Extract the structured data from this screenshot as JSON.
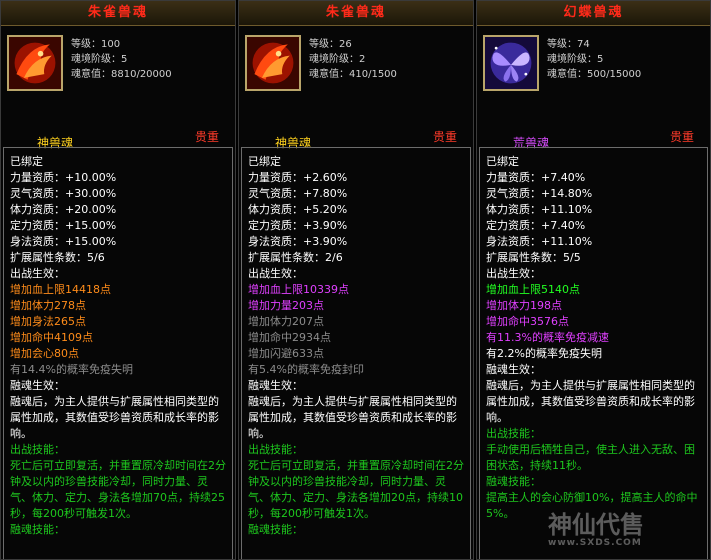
{
  "cards": [
    {
      "title": "朱雀兽魂",
      "level": "等级：100",
      "realm": "魂境阶级：5",
      "soul": "魂意值：8810/20000",
      "type": "神兽魂",
      "precious": "贵重",
      "bound": "已绑定",
      "attrs": [
        "力量资质：+10.00%",
        "灵气资质：+30.00%",
        "体力资质：+20.00%",
        "定力资质：+15.00%",
        "身法资质：+15.00%"
      ],
      "ext": "扩展属性条数：5/6",
      "battle_label": "出战生效：",
      "effects": [
        {
          "text": "增加血上限14418点",
          "color": "o"
        },
        {
          "text": "增加体力278点",
          "color": "o"
        },
        {
          "text": "增加身法265点",
          "color": "o"
        },
        {
          "text": "增加命中4109点",
          "color": "o"
        },
        {
          "text": "增加会心80点",
          "color": "o"
        },
        {
          "text": "有14.4%的概率免疫失明",
          "color": "g"
        }
      ],
      "fuse_label": "融魂生效：",
      "fuse_text": "融魂后，为主人提供与扩展属性相同类型的属性加成，其数值受珍兽资质和成长率的影响。",
      "skill_label": "出战技能：",
      "skill_text": "死亡后可立即复活，并重置原冷却时间在2分钟及以内的珍兽技能冷却，同时力量、灵气、体力、定力、身法各增加70点，持续25秒，每200秒可触发1次。",
      "fuse_skill_label": "融魂技能："
    },
    {
      "title": "朱雀兽魂",
      "level": "等级：26",
      "realm": "魂境阶级：2",
      "soul": "魂意值：410/1500",
      "type": "神兽魂",
      "precious": "贵重",
      "bound": "已绑定",
      "attrs": [
        "力量资质：+2.60%",
        "灵气资质：+7.80%",
        "体力资质：+5.20%",
        "定力资质：+3.90%",
        "身法资质：+3.90%"
      ],
      "ext": "扩展属性条数：2/6",
      "battle_label": "出战生效：",
      "effects": [
        {
          "text": "增加血上限10339点",
          "color": "p"
        },
        {
          "text": "增加力量203点",
          "color": "p"
        },
        {
          "text": "增加体力207点",
          "color": "g"
        },
        {
          "text": "增加命中2934点",
          "color": "g"
        },
        {
          "text": "增加闪避633点",
          "color": "g"
        },
        {
          "text": "有5.4%的概率免疫封印",
          "color": "g"
        }
      ],
      "fuse_label": "融魂生效：",
      "fuse_text": "融魂后，为主人提供与扩展属性相同类型的属性加成，其数值受珍兽资质和成长率的影响。",
      "skill_label": "出战技能：",
      "skill_text": "死亡后可立即复活，并重置原冷却时间在2分钟及以内的珍兽技能冷却，同时力量、灵气、体力、定力、身法各增加20点，持续10秒，每200秒可触发1次。",
      "fuse_skill_label": "融魂技能："
    },
    {
      "title": "幻蝶兽魂",
      "level": "等级：74",
      "realm": "魂境阶级：5",
      "soul": "魂意值：500/15000",
      "type": "荒兽魂",
      "precious": "贵重",
      "bound": "已绑定",
      "attrs": [
        "力量资质：+7.40%",
        "灵气资质：+14.80%",
        "体力资质：+11.10%",
        "定力资质：+7.40%",
        "身法资质：+11.10%"
      ],
      "ext": "扩展属性条数：5/5",
      "battle_label": "出战生效：",
      "effects": [
        {
          "text": "增加血上限5140点",
          "color": "gr"
        },
        {
          "text": "增加体力198点",
          "color": "p"
        },
        {
          "text": "增加命中3576点",
          "color": "p"
        },
        {
          "text": "有11.3%的概率免疫减速",
          "color": "p"
        },
        {
          "text": "有2.2%的概率免疫失明",
          "color": "w"
        }
      ],
      "fuse_label": "融魂生效：",
      "fuse_text": "融魂后，为主人提供与扩展属性相同类型的属性加成，其数值受珍兽资质和成长率的影响。",
      "skill_label": "出战技能：",
      "skill_text": "手动使用后牺牲自己，使主人进入无敌、困困状态，持续11秒。",
      "fuse_skill_label": "融魂技能：",
      "fuse_skill_text": "提高主人的会心防御10%，提高主人的命中5%。"
    }
  ],
  "watermark": {
    "logo": "神仙代售",
    "url": "www.SXDS.COM"
  }
}
